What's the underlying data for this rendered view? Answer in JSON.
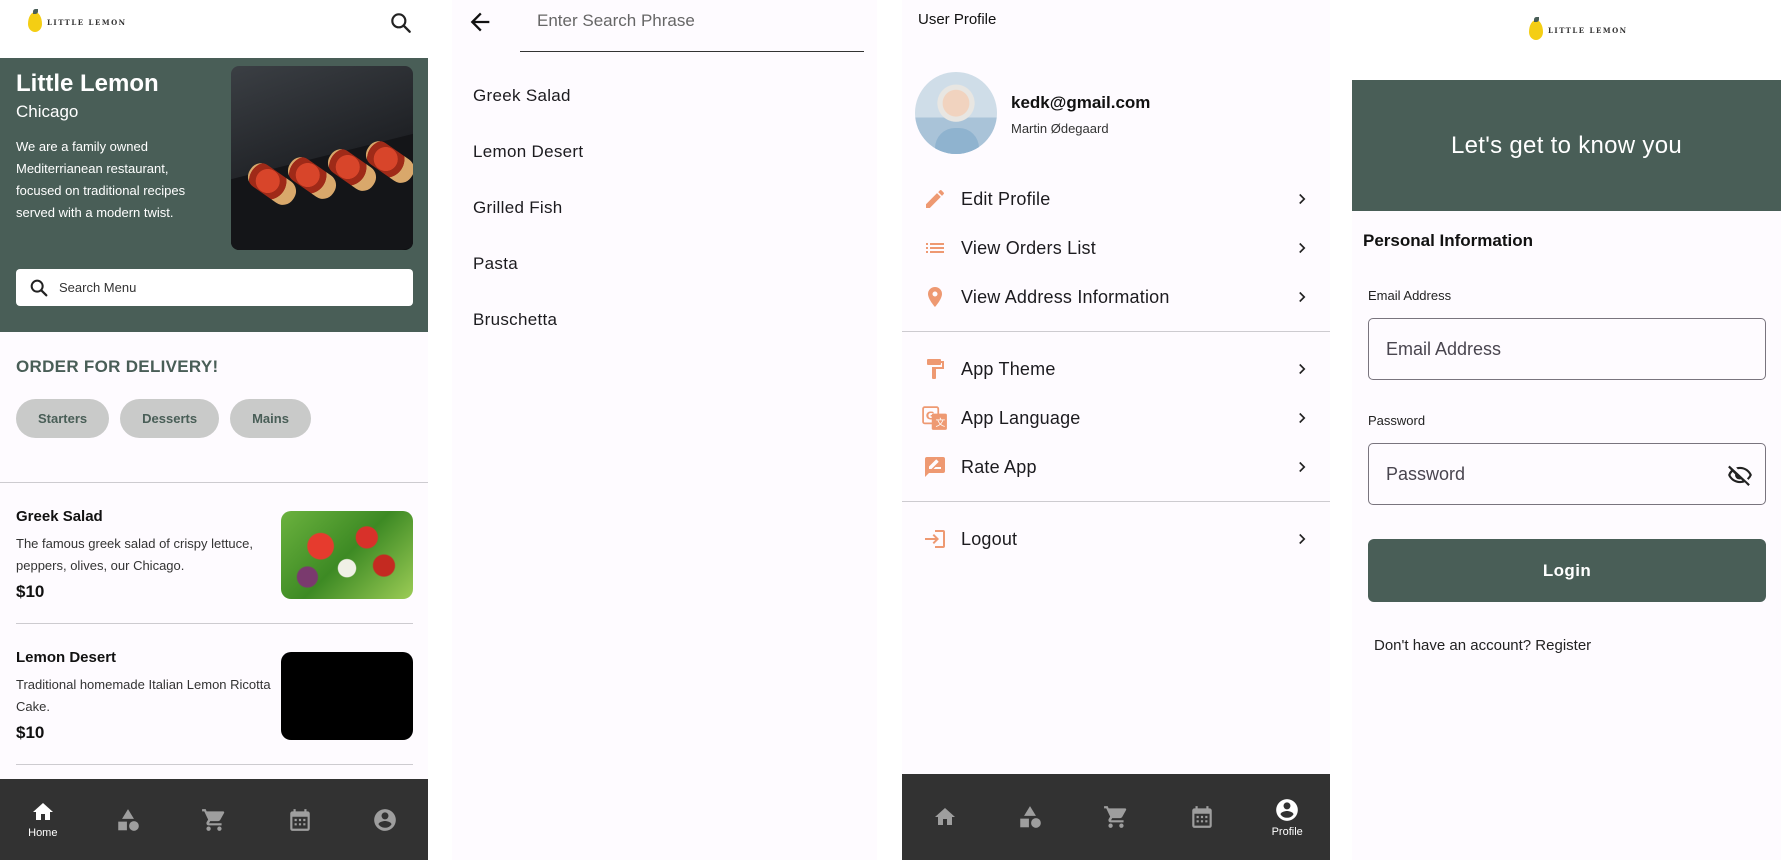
{
  "home": {
    "logo_text": "LITTLE LEMON",
    "hero": {
      "title": "Little Lemon",
      "city": "Chicago",
      "description": "We are a family owned Mediterrianean restaurant, focused on traditional recipes served with a modern twist.",
      "search_placeholder": "Search Menu"
    },
    "delivery_heading": "ORDER FOR DELIVERY!",
    "categories": [
      "Starters",
      "Desserts",
      "Mains"
    ],
    "items": [
      {
        "name": "Greek Salad",
        "description": "The famous greek salad of crispy lettuce, peppers, olives, our Chicago.",
        "price": "$10"
      },
      {
        "name": "Lemon Desert",
        "description": "Traditional homemade Italian Lemon Ricotta Cake.",
        "price": "$10"
      }
    ],
    "nav": {
      "active_label": "Home",
      "items": [
        "home-icon",
        "categories-icon",
        "cart-icon",
        "calendar-icon",
        "account-icon"
      ]
    }
  },
  "search": {
    "placeholder": "Enter Search Phrase",
    "results": [
      "Greek Salad",
      "Lemon Desert",
      "Grilled Fish",
      "Pasta",
      "Bruschetta"
    ]
  },
  "profile": {
    "title": "User Profile",
    "email": "kedk@gmail.com",
    "name": "Martin Ødegaard",
    "rows": {
      "edit": "Edit Profile",
      "orders": "View Orders List",
      "address": "View Address Information",
      "theme": "App Theme",
      "language": "App Language",
      "rate": "Rate App",
      "logout": "Logout"
    },
    "nav": {
      "active_label": "Profile"
    }
  },
  "onboarding": {
    "logo_text": "LITTLE LEMON",
    "banner": "Let's get to know you",
    "section": "Personal Information",
    "email_label": "Email Address",
    "email_placeholder": "Email Address",
    "password_label": "Password",
    "password_placeholder": "Password",
    "login_label": "Login",
    "register_text": "Don't have an account? Register"
  },
  "colors": {
    "primary": "#495e57",
    "accent_icon": "#ee9972",
    "nav_bg": "#323232",
    "chip_bg": "#c9cac9"
  }
}
